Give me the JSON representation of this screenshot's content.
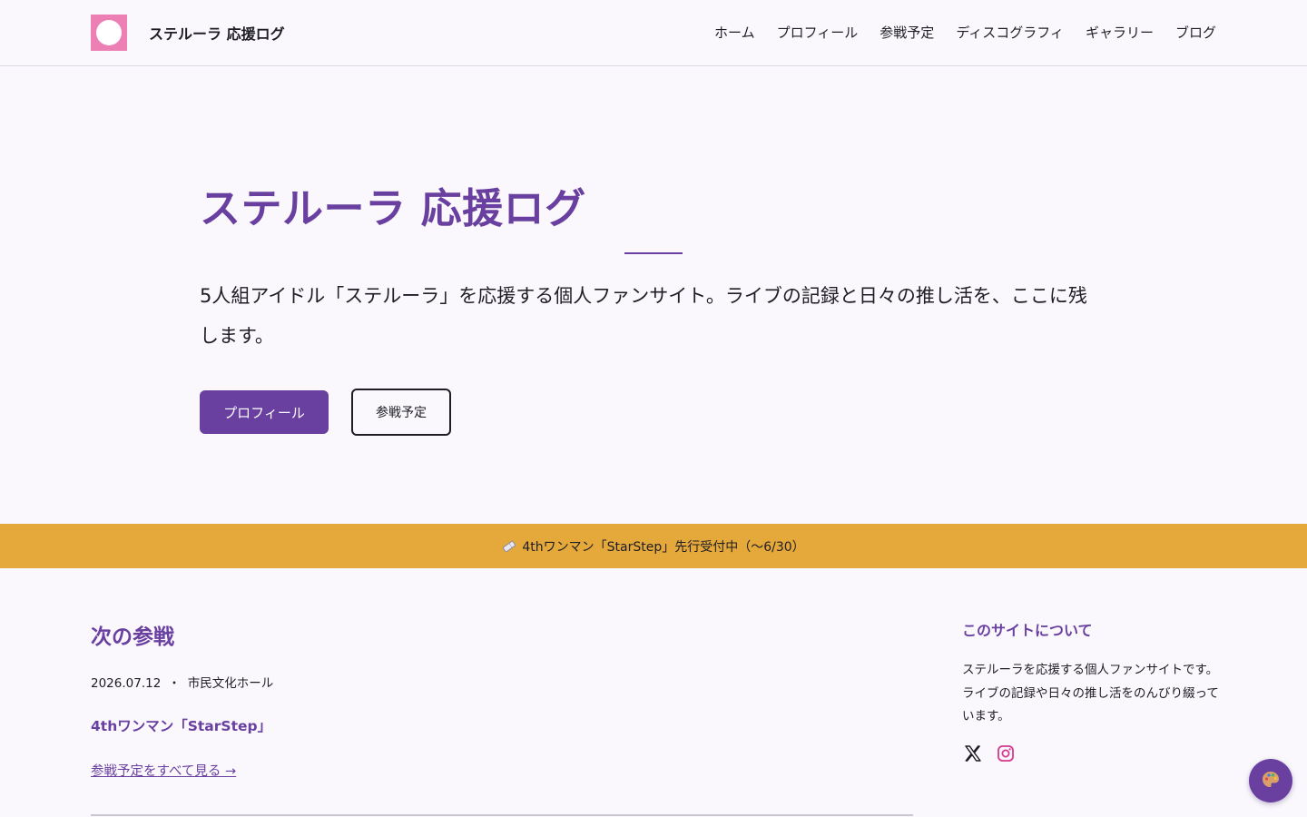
{
  "site": {
    "brand_name": "ステルーラ 応援ログ"
  },
  "nav": {
    "items": [
      {
        "label": "ホーム"
      },
      {
        "label": "プロフィール"
      },
      {
        "label": "参戦予定"
      },
      {
        "label": "ディスコグラフィ"
      },
      {
        "label": "ギャラリー"
      },
      {
        "label": "ブログ"
      }
    ]
  },
  "hero": {
    "title": "ステルーラ 応援ログ",
    "lead": "5人組アイドル「ステルーラ」を応援する個人ファンサイト。ライブの記録と日々の推し活を、ここに残します。",
    "primary_button": "プロフィール",
    "secondary_button": "参戦予定"
  },
  "announcement": {
    "text": "4thワンマン「StarStep」先行受付中（〜6/30）",
    "icon": "ticket-icon"
  },
  "next_event": {
    "heading": "次の参戦",
    "date": "2026.07.12",
    "separator": "・",
    "venue": "市民文化ホール",
    "title": "4thワンマン「StarStep」",
    "link_text": "参戦予定をすべて見る →"
  },
  "about": {
    "heading": "このサイトについて",
    "body": "ステルーラを応援する個人ファンサイトです。ライブの記録や日々の推し活をのんびり綴っています。",
    "social": [
      "x-icon",
      "instagram-icon"
    ]
  },
  "fab": {
    "icon": "palette-icon"
  },
  "colors": {
    "accent": "#6940a0",
    "logo_pink": "#ec7fb4",
    "announcement_bg": "#e5a83a",
    "background": "#faf8fd",
    "instagram": "#d6398f"
  }
}
